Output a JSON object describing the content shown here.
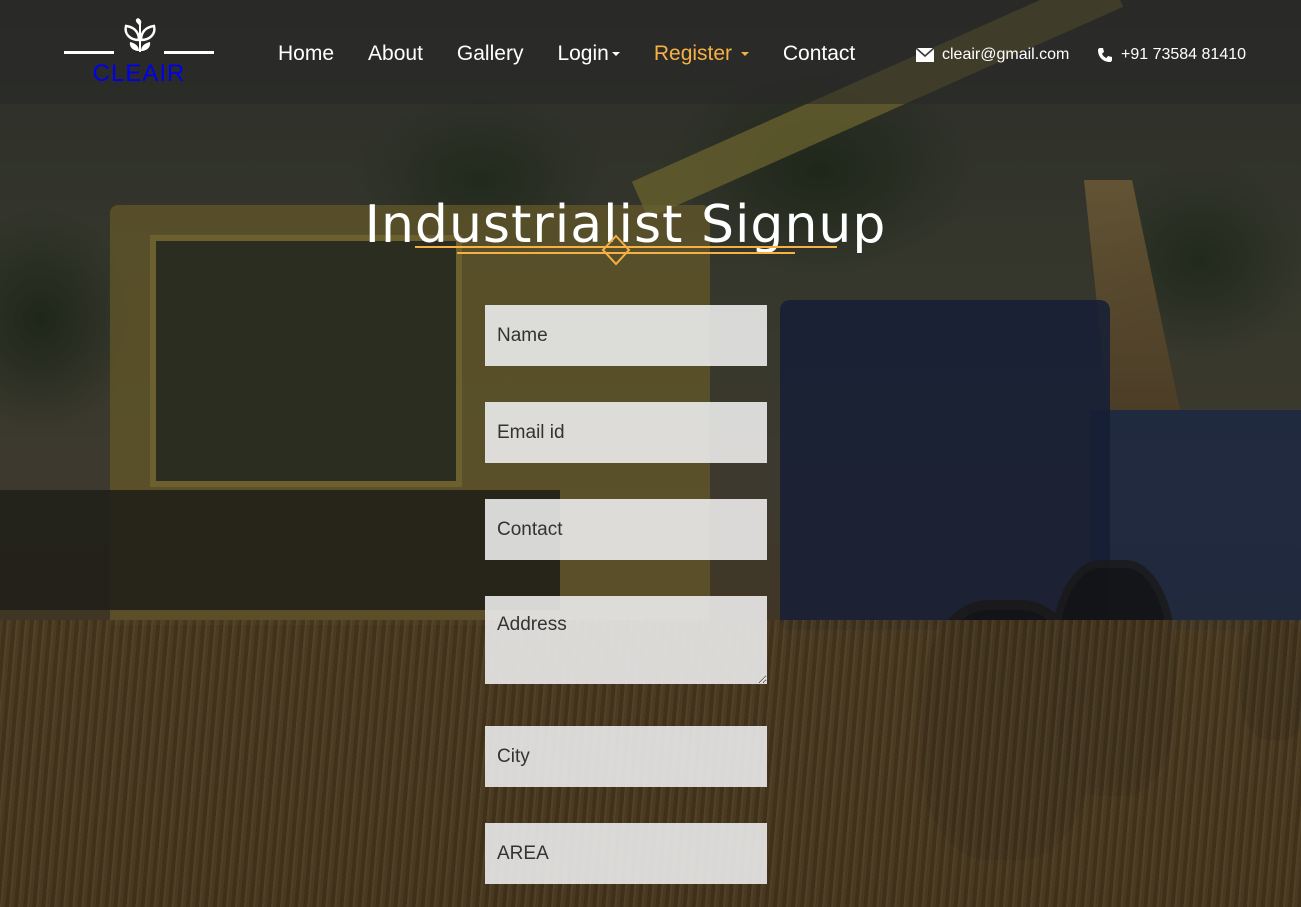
{
  "brand": {
    "name": "CLEAIR"
  },
  "nav": {
    "home": "Home",
    "about": "About",
    "gallery": "Gallery",
    "login": "Login",
    "register": "Register",
    "contact": "Contact"
  },
  "contact_info": {
    "email": "cleair@gmail.com",
    "phone": "+91 73584 81410"
  },
  "page": {
    "title": "Industrialist Signup"
  },
  "form": {
    "name_placeholder": "Name",
    "email_placeholder": "Email id",
    "contact_placeholder": "Contact",
    "address_placeholder": "Address",
    "city_placeholder": "City",
    "area_placeholder": "AREA"
  },
  "colors": {
    "accent": "#f6b044",
    "navbar": "#282828"
  },
  "icons": {
    "logo": "leaf-icon",
    "email": "envelope-icon",
    "phone": "phone-icon"
  }
}
